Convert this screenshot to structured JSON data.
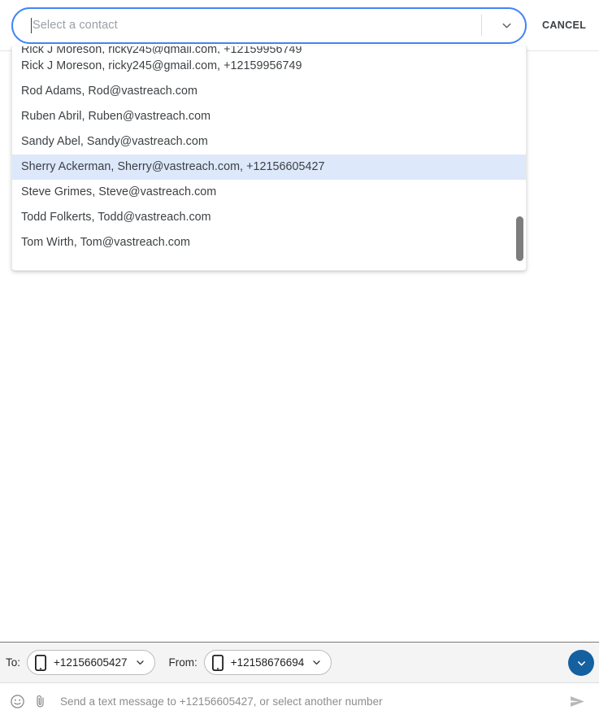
{
  "header": {
    "contact_input": {
      "placeholder": "Select a contact",
      "value": ""
    },
    "dropdown_toggle_icon": "chevron-down-icon",
    "cancel_label": "CANCEL"
  },
  "dropdown": {
    "options": [
      {
        "label": "Rick J Moreson, ricky245@gmail.com, +12159956749",
        "selected": false
      },
      {
        "label": "Rod Adams, Rod@vastreach.com",
        "selected": false
      },
      {
        "label": "Ruben Abril, Ruben@vastreach.com",
        "selected": false
      },
      {
        "label": "Sandy Abel, Sandy@vastreach.com",
        "selected": false
      },
      {
        "label": "Sherry Ackerman, Sherry@vastreach.com, +12156605427",
        "selected": true
      },
      {
        "label": "Steve Grimes, Steve@vastreach.com",
        "selected": false
      },
      {
        "label": "Todd Folkerts, Todd@vastreach.com",
        "selected": false
      },
      {
        "label": "Tom Wirth, Tom@vastreach.com",
        "selected": false
      }
    ]
  },
  "recipients": {
    "to_label": "To:",
    "to_number": "+12156605427",
    "from_label": "From:",
    "from_number": "+12158676694",
    "phone_icon": "smartphone-icon",
    "chip_chevron_icon": "chevron-down-icon",
    "collapse_icon": "chevron-down-icon"
  },
  "compose": {
    "emoji_icon": "emoji-smiley-icon",
    "attach_icon": "paperclip-icon",
    "placeholder": "Send a text message to +12156605427, or select another number",
    "value": "",
    "send_icon": "send-arrow-icon"
  },
  "colors": {
    "focus_border": "#4285f4",
    "selected_option_bg": "#dde8fb",
    "collapse_button_bg": "#15609f",
    "bar_bg": "#f4f4f4"
  }
}
